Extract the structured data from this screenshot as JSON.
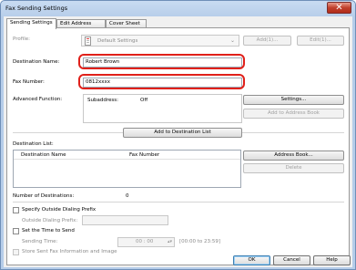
{
  "window": {
    "title": "Fax Sending Settings",
    "close_glyph": "✕"
  },
  "tabs": [
    {
      "label": "Sending Settings",
      "active": true
    },
    {
      "label": "Edit Address Book",
      "active": false
    },
    {
      "label": "Cover Sheet",
      "active": false
    }
  ],
  "profile": {
    "label": "Profile:",
    "value": "Default Settings",
    "add_button": "Add(1)...",
    "edit_button": "Edit(1)..."
  },
  "destination_name": {
    "label": "Destination Name:",
    "value": "Robert Brown"
  },
  "fax_number": {
    "label": "Fax Number:",
    "value": "0812xxxx"
  },
  "advanced_function": {
    "label": "Advanced Function:",
    "subaddress_label": "Subaddress:",
    "subaddress_value": "Off",
    "settings_button": "Settings...",
    "add_to_address_book_button": "Add to Address Book"
  },
  "add_to_destination_list_button": "Add to Destination List",
  "destination_list": {
    "label": "Destination List:",
    "columns": [
      "Destination Name",
      "Fax Number"
    ],
    "address_book_button": "Address Book...",
    "delete_button": "Delete",
    "count_label": "Number of Destinations:",
    "count_value": "0"
  },
  "outside_dialing": {
    "checkbox_label": "Specify Outside Dialing Prefix",
    "prefix_label": "Outside Dialing Prefix:",
    "checked": false
  },
  "send_time": {
    "checkbox_label": "Set the Time to Send",
    "time_label": "Sending Time:",
    "time_value": "00 : 00",
    "range_hint": "[00:00 to 23:59]",
    "checked": false
  },
  "store_fax": {
    "checkbox_label": "Store Sent Fax Information and Image",
    "checked": false
  },
  "footer": {
    "ok": "OK",
    "cancel": "Cancel",
    "help": "Help"
  },
  "colors": {
    "highlight": "#e0201a",
    "title_bar": "#b6cde9",
    "close_button": "#c0402c"
  }
}
